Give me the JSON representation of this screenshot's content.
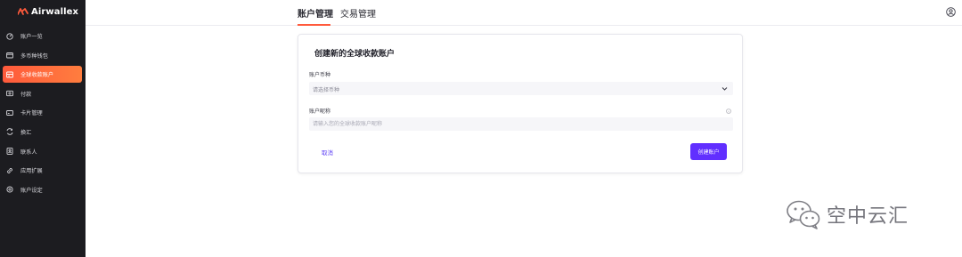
{
  "brand": {
    "name": "Airwallex",
    "accent": "#ff5a3c"
  },
  "sidebar": {
    "items": [
      {
        "label": "账户一览",
        "icon": "dashboard-icon"
      },
      {
        "label": "多币种钱包",
        "icon": "wallet-icon"
      },
      {
        "label": "全球收款账户",
        "icon": "bank-account-icon",
        "active": true
      },
      {
        "label": "付款",
        "icon": "payment-icon"
      },
      {
        "label": "卡片管理",
        "icon": "card-icon"
      },
      {
        "label": "换汇",
        "icon": "exchange-icon"
      },
      {
        "label": "联系人",
        "icon": "contacts-icon"
      },
      {
        "label": "应用扩展",
        "icon": "link-icon"
      },
      {
        "label": "账户设定",
        "icon": "settings-icon"
      }
    ]
  },
  "topbar": {
    "tabs": [
      {
        "label": "账户管理",
        "active": true
      },
      {
        "label": "交易管理",
        "active": false
      }
    ],
    "user_icon": "user-icon"
  },
  "form": {
    "title": "创建新的全球收款账户",
    "currency_label": "账户币种",
    "currency_placeholder": "请选择币种",
    "name_label": "账户昵称",
    "name_placeholder": "请输入您的全球收款账户昵称",
    "cancel_label": "取消",
    "submit_label": "创建账户",
    "submit_color": "#612fff"
  },
  "watermark": {
    "text": "空中云汇",
    "icon": "wechat-icon"
  }
}
